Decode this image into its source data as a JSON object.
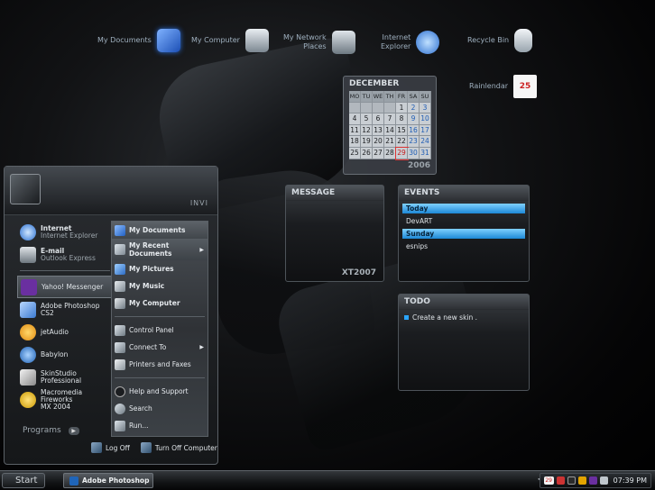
{
  "desktop": {
    "icons": [
      {
        "label": "My Documents"
      },
      {
        "label": "My Computer"
      },
      {
        "label": "My Network Places",
        "line1": "My Network",
        "line2": "Places"
      },
      {
        "label": "Internet Explorer",
        "line1": "Internet",
        "line2": "Explorer"
      },
      {
        "label": "Recycle Bin"
      },
      {
        "label": "Rainlendar"
      }
    ],
    "rainlendar_icon_date": "25"
  },
  "calendar": {
    "month": "DECEMBER",
    "year": "2006",
    "weekday_headers": [
      "MO",
      "TU",
      "WE",
      "TH",
      "FR",
      "SA",
      "SU"
    ],
    "days": [
      "",
      "",
      "",
      "",
      "1",
      "2",
      "3",
      "4",
      "5",
      "6",
      "7",
      "8",
      "9",
      "10",
      "11",
      "12",
      "13",
      "14",
      "15",
      "16",
      "17",
      "18",
      "19",
      "20",
      "21",
      "22",
      "23",
      "24",
      "25",
      "26",
      "27",
      "28",
      "29",
      "30",
      "31"
    ],
    "selected_day": "29"
  },
  "message_widget": {
    "title": "MESSAGE",
    "footer": "XT2007"
  },
  "events_widget": {
    "title": "EVENTS",
    "items": [
      {
        "text": "Today",
        "highlight": true
      },
      {
        "text": "DevART",
        "highlight": false
      },
      {
        "text": "Sunday",
        "highlight": true
      },
      {
        "text": "esnips",
        "highlight": false
      }
    ]
  },
  "todo_widget": {
    "title": "TODO",
    "items": [
      "Create a new skin ."
    ]
  },
  "start_menu": {
    "username": "INVI",
    "pinned": [
      {
        "title": "Internet",
        "subtitle": "Internet Explorer",
        "icon": "ie-icon"
      },
      {
        "title": "E-mail",
        "subtitle": "Outlook Express",
        "icon": "email-icon"
      }
    ],
    "recent": [
      {
        "line1": "Yahoo! Messenger",
        "line2": "",
        "icon": "yahoo-messenger-icon",
        "highlight": true
      },
      {
        "line1": "Adobe Photoshop CS2",
        "line2": "",
        "icon": "photoshop-icon"
      },
      {
        "line1": "jetAudio",
        "line2": "",
        "icon": "jetaudio-icon"
      },
      {
        "line1": "Babylon",
        "line2": "",
        "icon": "babylon-icon"
      },
      {
        "line1": "SkinStudio",
        "line2": "Professional",
        "icon": "skinstudio-icon"
      },
      {
        "line1": "Macromedia Fireworks",
        "line2": "MX 2004",
        "icon": "fireworks-icon"
      }
    ],
    "programs_label": "Programs",
    "right_bold": [
      {
        "label": "My Documents",
        "line2": "",
        "icon": "my-documents-icon",
        "highlight": true
      },
      {
        "label": "My Recent",
        "line2": "Documents",
        "icon": "recent-documents-icon",
        "highlight": true,
        "has_arrow": true
      },
      {
        "label": "My Pictures",
        "line2": "",
        "icon": "my-pictures-icon"
      },
      {
        "label": "My Music",
        "line2": "",
        "icon": "my-music-icon"
      },
      {
        "label": "My Computer",
        "line2": "",
        "icon": "my-computer-icon"
      }
    ],
    "right_system": [
      {
        "label": "Control Panel",
        "icon": "control-panel-icon"
      },
      {
        "label": "Connect To",
        "icon": "connect-to-icon",
        "has_arrow": true
      },
      {
        "label": "Printers and Faxes",
        "icon": "printer-icon"
      }
    ],
    "right_help": [
      {
        "label": "Help and Support",
        "icon": "help-icon"
      },
      {
        "label": "Search",
        "icon": "search-icon"
      },
      {
        "label": "Run...",
        "icon": "run-icon"
      }
    ],
    "log_off": "Log Off",
    "turn_off": "Turn Off Computer"
  },
  "taskbar": {
    "start_label": "Start",
    "tasks": [
      {
        "label": "Adobe Photoshop"
      }
    ],
    "tray_date_icon": "29",
    "clock": "07:39 PM"
  }
}
